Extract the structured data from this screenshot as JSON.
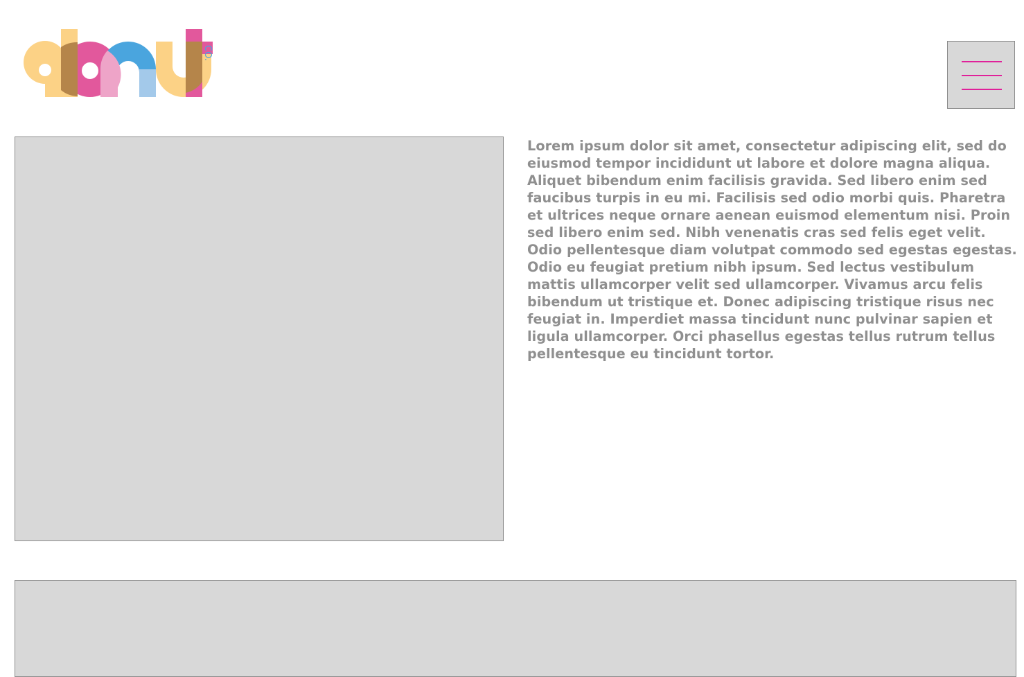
{
  "header": {
    "logo": {
      "word": "donut",
      "suffix": "CO.",
      "colors": {
        "yellow": "#fcd286",
        "pink": "#e2589c",
        "blue": "#4aa5de",
        "brown": "#b5854a",
        "light_pink": "#eea4c8",
        "light_blue": "#a3c9ea"
      }
    },
    "menu": {
      "icon": "hamburger-menu-icon",
      "line_color": "#e0219a"
    }
  },
  "main": {
    "description": "Lorem ipsum dolor sit amet, consectetur adipiscing elit, sed do eiusmod tempor incididunt ut labore et dolore magna aliqua. Aliquet bibendum enim facilisis gravida. Sed libero enim sed faucibus turpis in eu mi. Facilisis sed odio morbi quis. Pharetra et ultrices neque ornare aenean euismod elementum nisi. Proin sed libero enim sed. Nibh venenatis cras sed felis eget velit. Odio pellentesque diam volutpat commodo sed egestas egestas. Odio eu feugiat pretium nibh ipsum. Sed lectus vestibulum mattis ullamcorper velit sed ullamcorper. Vivamus arcu felis bibendum ut tristique et. Donec adipiscing tristique risus nec feugiat in. Imperdiet massa tincidunt nunc pulvinar sapien et ligula ullamcorper. Orci phasellus egestas tellus rutrum tellus pellentesque eu tincidunt tortor."
  },
  "colors": {
    "placeholder_fill": "#d8d8d8",
    "placeholder_border": "#8a8a8a",
    "text": "#8f8f8f"
  }
}
